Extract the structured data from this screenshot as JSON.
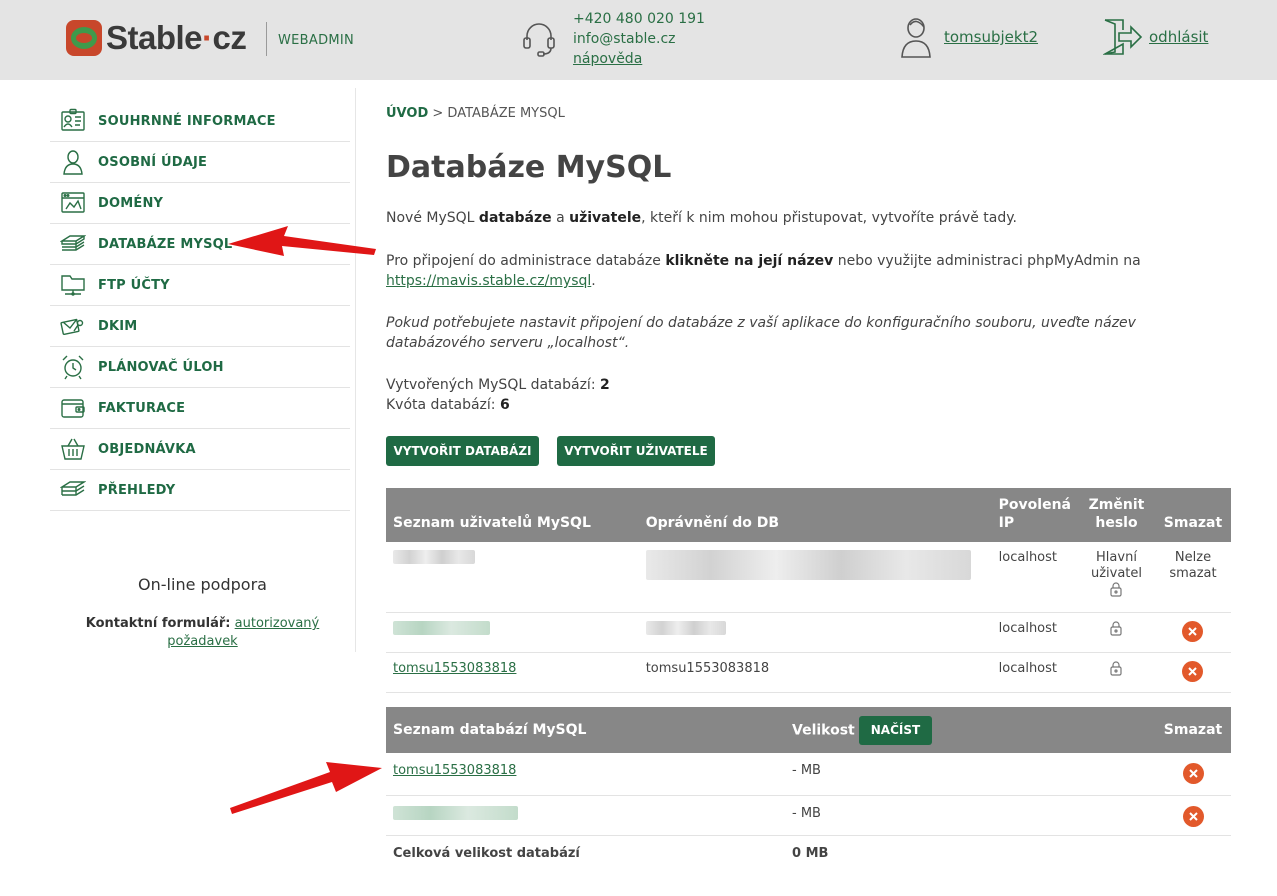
{
  "header": {
    "logo_text": "Stable",
    "logo_dot": "·",
    "logo_tld": "cz",
    "section_label": "WEBADMIN",
    "phone": "+420 480 020 191",
    "email": "info@stable.cz",
    "help_link": "nápověda",
    "username": "tomsubjekt2",
    "logout": "odhlásit"
  },
  "sidebar": {
    "items": [
      {
        "label": "SOUHRNNÉ INFORMACE",
        "icon": "id-card-icon"
      },
      {
        "label": "OSOBNÍ ÚDAJE",
        "icon": "person-icon"
      },
      {
        "label": "DOMÉNY",
        "icon": "browser-icon"
      },
      {
        "label": "DATABÁZE MYSQL",
        "icon": "database-icon"
      },
      {
        "label": "FTP ÚČTY",
        "icon": "folder-network-icon"
      },
      {
        "label": "DKIM",
        "icon": "mail-key-icon"
      },
      {
        "label": "PLÁNOVAČ ÚLOH",
        "icon": "alarm-clock-icon"
      },
      {
        "label": "FAKTURACE",
        "icon": "wallet-icon"
      },
      {
        "label": "OBJEDNÁVKA",
        "icon": "basket-icon"
      },
      {
        "label": "PŘEHLEDY",
        "icon": "layers-icon"
      }
    ],
    "support_title": "On-line podpora",
    "support_label": "Kontaktní formulář:",
    "support_link": "autorizovaný požadavek"
  },
  "main": {
    "breadcrumb_home": "ÚVOD",
    "breadcrumb_sep": " > ",
    "breadcrumb_current": "DATABÁZE MYSQL",
    "title": "Databáze MySQL",
    "intro": {
      "t1": "Nové MySQL ",
      "b1": "databáze",
      "t2": " a ",
      "b2": "uživatele",
      "t3": ", kteří k nim mohou přistupovat, vytvoříte právě tady."
    },
    "connect": {
      "t1": "Pro připojení do administrace databáze ",
      "b1": "klikněte na její název",
      "t2": " nebo využijte administraci phpMyAdmin na ",
      "link": "https://mavis.stable.cz/mysql",
      "t3": "."
    },
    "note": "Pokud potřebujete nastavit připojení do databáze z vaší aplikace do konfiguračního souboru, uveďte název databázového serveru „localhost“.",
    "stats": {
      "created_label": "Vytvořených MySQL databází: ",
      "created_value": "2",
      "quota_label": "Kvóta databází: ",
      "quota_value": "6"
    },
    "buttons": {
      "create_db": "VYTVOŘIT DATABÁZI",
      "create_user": "VYTVOŘIT UŽIVATELE"
    },
    "users_table": {
      "headers": {
        "name": "Seznam uživatelů MySQL",
        "rights": "Oprávnění do DB",
        "ip": "Povolená IP",
        "change_pw": "Změnit heslo",
        "delete": "Smazat"
      },
      "rows": [
        {
          "name": "tomsubjekt2",
          "rights": "",
          "ip": "localhost",
          "change_pw": "Hlavní uživatel",
          "delete": "Nelze smazat"
        },
        {
          "name": "",
          "rights": "",
          "ip": "localhost"
        },
        {
          "name": "tomsu1553083818",
          "rights": "tomsu1553083818",
          "ip": "localhost"
        }
      ]
    },
    "db_table": {
      "headers": {
        "name": "Seznam databází MySQL",
        "size": "Velikost",
        "load": "NAČÍST",
        "delete": "Smazat"
      },
      "rows": [
        {
          "name": "tomsu1553083818",
          "size": "- MB"
        },
        {
          "name": "",
          "size": "- MB"
        }
      ],
      "total_label": "Celková velikost databází",
      "total_value": "0 MB"
    }
  },
  "colors": {
    "brand_green": "#1f6a44",
    "header_bg": "#e4e4e4",
    "table_header": "#878787",
    "delete_orange": "#e2592b",
    "annotation_red": "#e01616"
  }
}
